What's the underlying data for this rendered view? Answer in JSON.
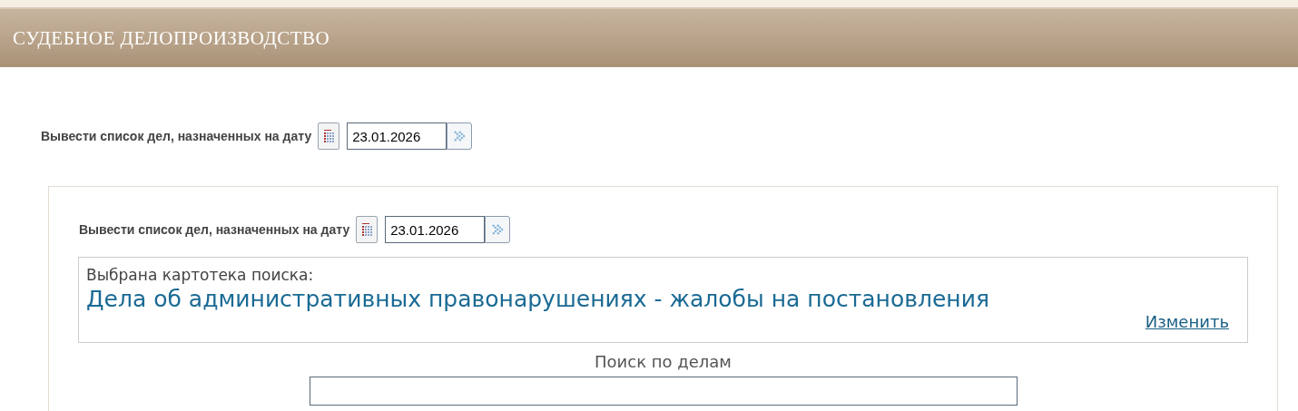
{
  "header": {
    "title": "СУДЕБНОЕ ДЕЛОПРОИЗВОДСТВО"
  },
  "date_filter": {
    "label": "Вывести список дел, назначенных на дату",
    "value": "23.01.2026"
  },
  "panel": {
    "date_filter": {
      "label": "Вывести список дел, назначенных на дату",
      "value": "23.01.2026"
    },
    "selected_catalog": {
      "label": "Выбрана картотека поиска:",
      "name": "Дела об административных правонарушениях - жалобы на постановления",
      "change_link": "Изменить"
    },
    "search": {
      "title": "Поиск по делам"
    }
  }
}
